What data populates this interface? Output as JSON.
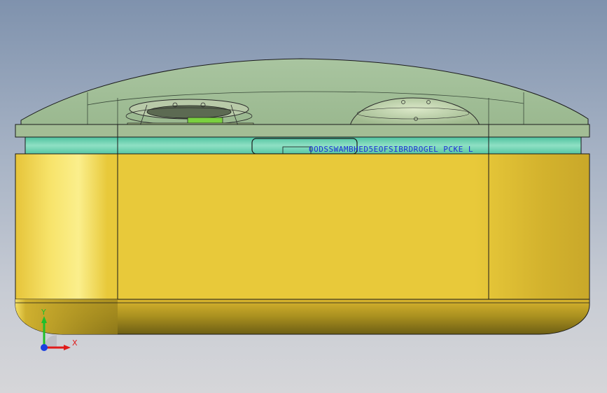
{
  "viewport": {
    "background_top": "#7f92ad",
    "background_bottom": "#d6d6d9"
  },
  "model": {
    "base_color": "#e8c93a",
    "base_shadow": "#b89a1e",
    "cover_color": "#a6c29a",
    "rim_color": "#62c9a6",
    "pcb_color": "#6fbf3f",
    "edge_color": "#1a1a1a",
    "dimension_text": "OODSSWAMBHED5EOFSIBRDROGEL PCKE L",
    "dimension_text_color": "#1f2fd8"
  },
  "triad": {
    "x_label": "X",
    "y_label": "Y",
    "x_color": "#e01b1b",
    "y_color": "#1fbf2a",
    "origin_color": "#1b3fe0"
  }
}
